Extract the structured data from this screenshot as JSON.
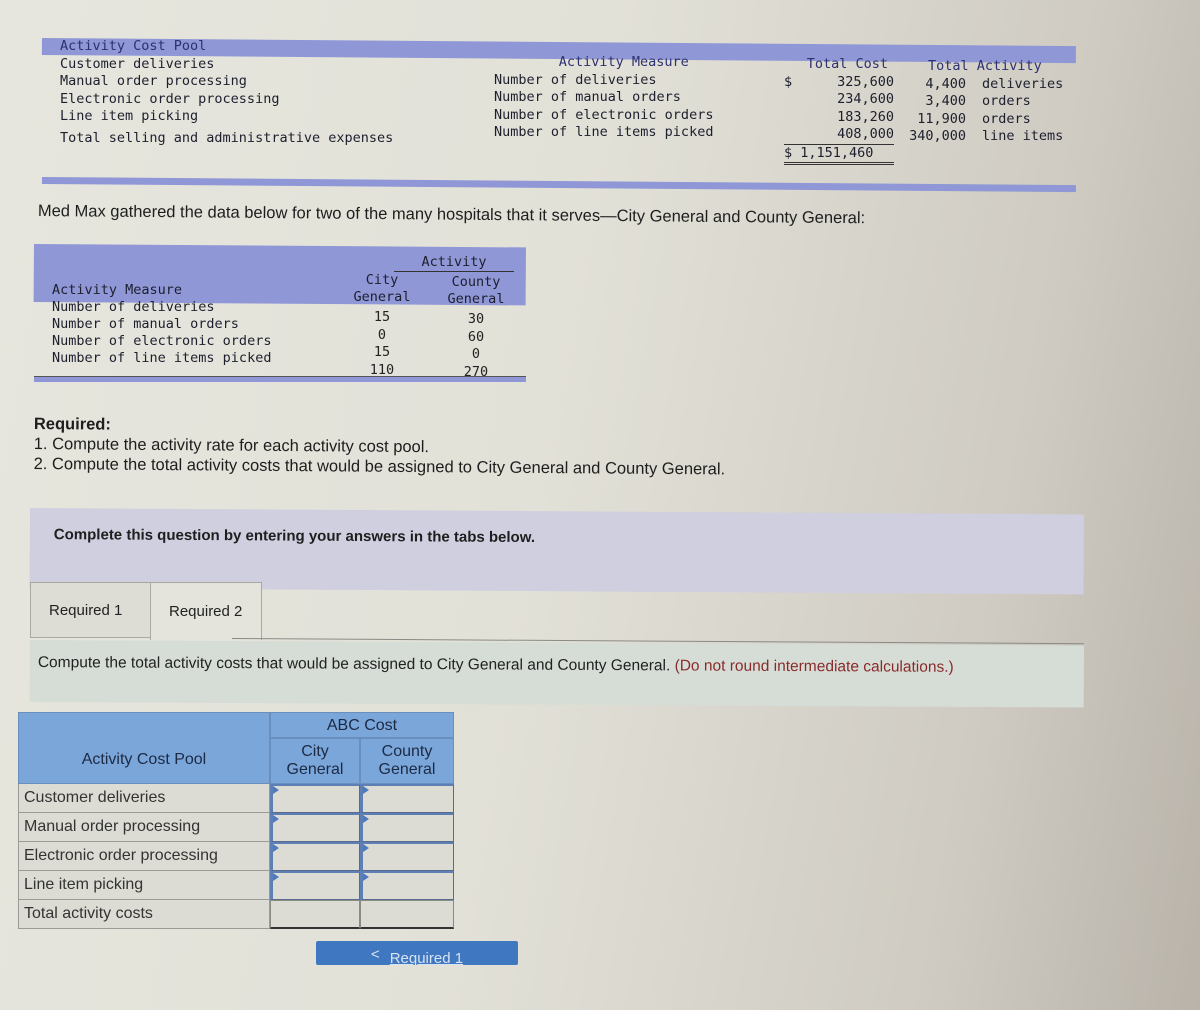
{
  "cost_pool_table": {
    "headers": {
      "pool": "Activity Cost Pool",
      "measure": "Activity Measure",
      "total_cost": "Total Cost",
      "total_activity": "Total Activity"
    },
    "rows": [
      {
        "pool": "Customer deliveries",
        "measure": "Number of deliveries",
        "cost_prefix": "$",
        "cost": "325,600",
        "activity": "4,400",
        "unit": "deliveries"
      },
      {
        "pool": "Manual order processing",
        "measure": "Number of manual orders",
        "cost_prefix": "",
        "cost": "234,600",
        "activity": "3,400",
        "unit": "orders"
      },
      {
        "pool": "Electronic order processing",
        "measure": "Number of electronic orders",
        "cost_prefix": "",
        "cost": "183,260",
        "activity": "11,900",
        "unit": "orders"
      },
      {
        "pool": "Line item picking",
        "measure": "Number of line items picked",
        "cost_prefix": "",
        "cost": "408,000",
        "activity": "340,000",
        "unit": "line items"
      }
    ],
    "total": {
      "label": "Total selling and administrative expenses",
      "value": "$ 1,151,460"
    }
  },
  "intro_text": "Med Max gathered the data below for two of the many hospitals that it serves—City General and County General:",
  "hospital_table": {
    "group_header": "Activity",
    "measure_header": "Activity Measure",
    "city_header": [
      "City",
      "General"
    ],
    "county_header": [
      "County",
      "General"
    ],
    "rows": [
      {
        "measure": "Number of deliveries",
        "city": "15",
        "county": "30"
      },
      {
        "measure": "Number of manual orders",
        "city": "0",
        "county": "60"
      },
      {
        "measure": "Number of electronic orders",
        "city": "15",
        "county": "0"
      },
      {
        "measure": "Number of line items picked",
        "city": "110",
        "county": "270"
      }
    ]
  },
  "required": {
    "title": "Required:",
    "items": [
      "1. Compute the activity rate for each activity cost pool.",
      "2. Compute the total activity costs that would be assigned to City General and County General."
    ]
  },
  "instruction": "Complete this question by entering your answers in the tabs below.",
  "tabs": [
    {
      "label": "Required 1",
      "active": false
    },
    {
      "label": "Required 2",
      "active": true
    }
  ],
  "panel": {
    "prompt": "Compute the total activity costs that would be assigned to City General and County General.",
    "note": "(Do not round intermediate calculations.)"
  },
  "answer_table": {
    "pool_header": "Activity Cost Pool",
    "group_header": "ABC Cost",
    "city_header": [
      "City",
      "General"
    ],
    "county_header": [
      "County",
      "General"
    ],
    "rows": [
      {
        "label": "Customer deliveries",
        "city": "",
        "county": ""
      },
      {
        "label": "Manual order processing",
        "city": "",
        "county": ""
      },
      {
        "label": "Electronic order processing",
        "city": "",
        "county": ""
      },
      {
        "label": "Line item picking",
        "city": "",
        "county": ""
      }
    ],
    "total_label": "Total activity costs"
  },
  "nav": {
    "prev_label": "Required 1",
    "prev_icon": "chevron-left-icon"
  }
}
